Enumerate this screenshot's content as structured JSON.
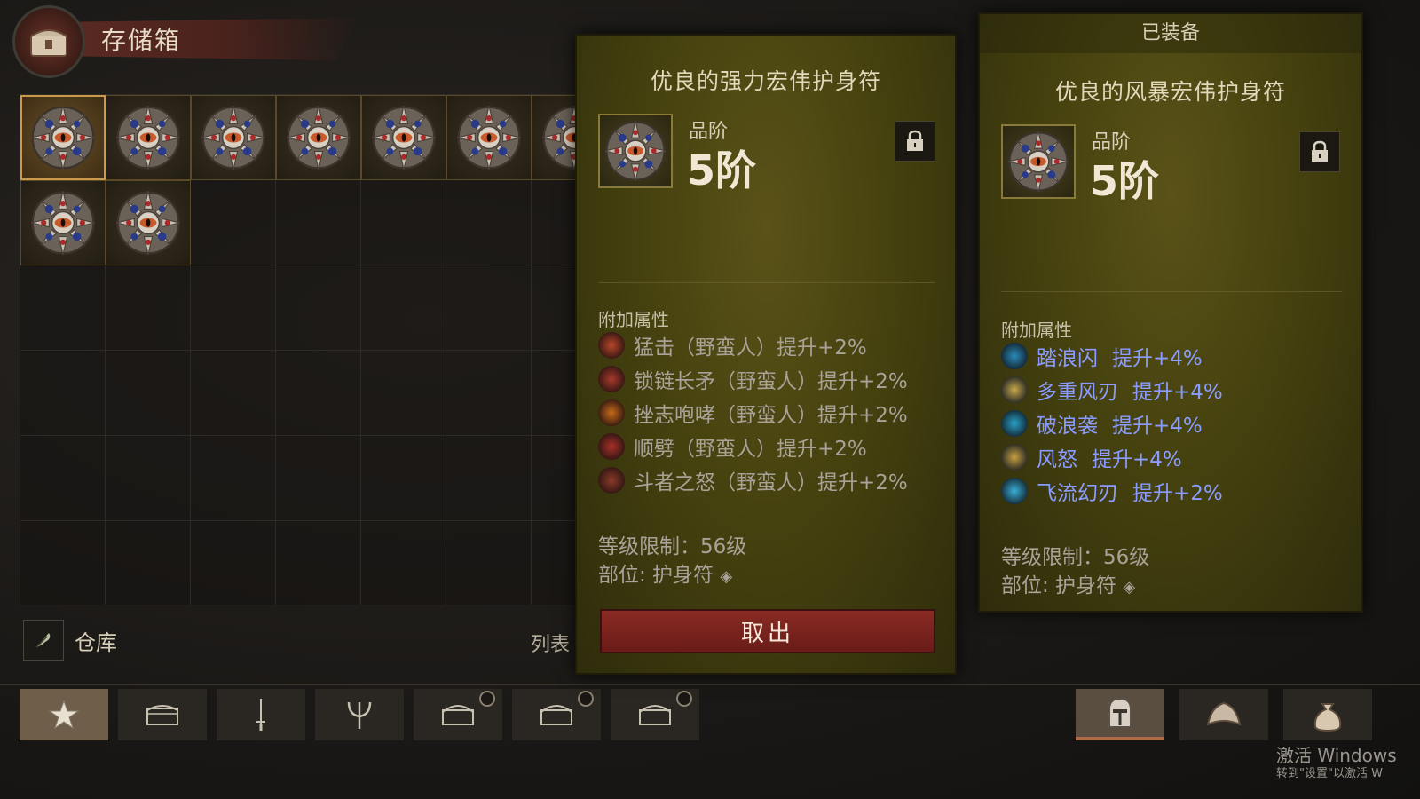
{
  "storage": {
    "title": "存储箱",
    "warehouse_label": "仓库",
    "list_label": "列表"
  },
  "grid": {
    "items_row1": 7,
    "items_row2": 2,
    "selected_index": 0
  },
  "tooltip_left": {
    "title": "优良的强力宏伟护身符",
    "tier_label": "品阶",
    "tier_value": "5阶",
    "affix_section": "附加属性",
    "affixes": [
      {
        "text": "猛击（野蛮人）提升+2%",
        "icon": "bash-skill-icon",
        "color": "#b8462a"
      },
      {
        "text": "锁链长矛（野蛮人）提升+2%",
        "icon": "chain-lance-skill-icon",
        "color": "#a83a2c"
      },
      {
        "text": "挫志咆哮（野蛮人）提升+2%",
        "icon": "demoralizing-shout-skill-icon",
        "color": "#c86a1a"
      },
      {
        "text": "顺劈（野蛮人）提升+2%",
        "icon": "cleave-skill-icon",
        "color": "#a8302a"
      },
      {
        "text": "斗者之怒（野蛮人）提升+2%",
        "icon": "fighters-rage-skill-icon",
        "color": "#8a3a2a"
      }
    ],
    "level_req": "等级限制：56级",
    "slot": "部位: 护身符",
    "takeout_button": "取出"
  },
  "tooltip_right": {
    "header": "已装备",
    "title": "优良的风暴宏伟护身符",
    "tier_label": "品阶",
    "tier_value": "5阶",
    "affix_section": "附加属性",
    "affixes": [
      {
        "name": "踏浪闪",
        "bonus": "提升+4%",
        "icon": "wave-step-skill-icon",
        "color": "#2a8ab8"
      },
      {
        "name": "多重风刃",
        "bonus": "提升+4%",
        "icon": "multi-wind-blade-skill-icon",
        "color": "#c8a84a"
      },
      {
        "name": "破浪袭",
        "bonus": "提升+4%",
        "icon": "wave-break-skill-icon",
        "color": "#2aa0c8"
      },
      {
        "name": "风怒",
        "bonus": "提升+4%",
        "icon": "wind-fury-skill-icon",
        "color": "#c8a040"
      },
      {
        "name": "飞流幻刃",
        "bonus": "提升+2%",
        "icon": "flowing-illusion-blade-skill-icon",
        "color": "#3ab0d8"
      }
    ],
    "level_req": "等级限制：56级",
    "slot": "部位: 护身符"
  },
  "bottom_tabs": [
    {
      "icon": "star-icon",
      "active": true
    },
    {
      "icon": "chest-icon",
      "active": false
    },
    {
      "icon": "sword-icon",
      "active": false
    },
    {
      "icon": "trident-icon",
      "active": false
    },
    {
      "icon": "locked-chest-icon",
      "active": false,
      "badge": true
    },
    {
      "icon": "locked-chest-icon",
      "active": false,
      "badge": true
    },
    {
      "icon": "locked-chest-icon",
      "active": false,
      "badge": true
    }
  ],
  "right_tabs": [
    {
      "icon": "helmet-icon",
      "active": true
    },
    {
      "icon": "shoulder-armor-icon",
      "active": false
    },
    {
      "icon": "money-bag-icon",
      "active": false
    }
  ],
  "watermark": {
    "line1": "激活 Windows",
    "line2": "转到\"设置\"以激活 W"
  }
}
